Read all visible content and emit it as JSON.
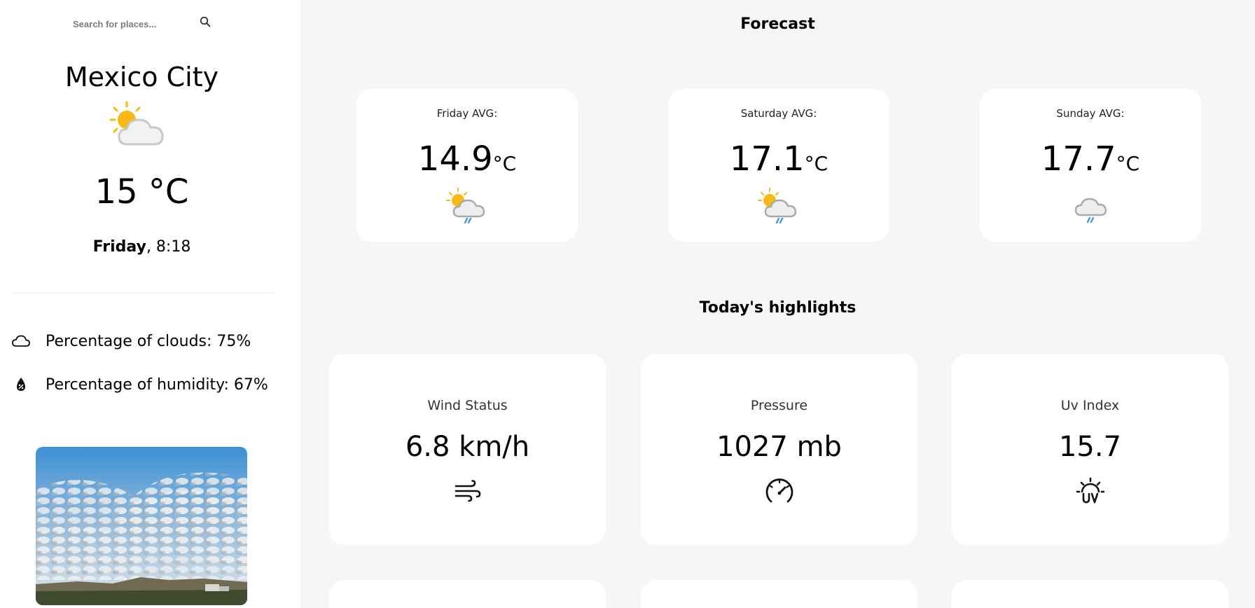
{
  "search": {
    "placeholder": "Search for places..."
  },
  "current": {
    "city": "Mexico City",
    "temperature": "15 °C",
    "day": "Friday",
    "time": ", 8:18",
    "icon": "partly-cloudy-icon"
  },
  "stats": {
    "clouds": "Percentage of clouds: 75%",
    "humidity": "Percentage of humidity: 67%"
  },
  "forecast": {
    "title": "Forecast",
    "days": [
      {
        "label": "Friday AVG:",
        "value": "14.9",
        "unit": "°C",
        "icon": "sun-cloud-rain-icon"
      },
      {
        "label": "Saturday AVG:",
        "value": "17.1",
        "unit": "°C",
        "icon": "sun-cloud-rain-icon"
      },
      {
        "label": "Sunday AVG:",
        "value": "17.7",
        "unit": "°C",
        "icon": "cloud-rain-icon"
      }
    ]
  },
  "highlights": {
    "title": "Today's highlights",
    "items": [
      {
        "label": "Wind Status",
        "value": "6.8 km/h",
        "icon": "wind-icon"
      },
      {
        "label": "Pressure",
        "value": "1027 mb",
        "icon": "gauge-icon"
      },
      {
        "label": "Uv Index",
        "value": "15.7",
        "icon": "uv-index-icon"
      }
    ]
  },
  "colors": {
    "background": "#f6f6f8",
    "card": "#ffffff",
    "sun": "#f9b814",
    "rain": "#2f8fe0"
  }
}
